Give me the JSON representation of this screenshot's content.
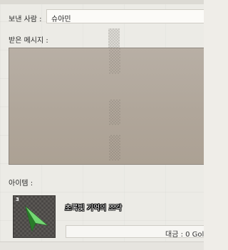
{
  "sender": {
    "label": "보낸 사람 :",
    "value": "슈아민"
  },
  "message": {
    "label": "받은 메시지 :",
    "body": ""
  },
  "item": {
    "label": "아이템 :",
    "name": "초록빛 기억의 조각",
    "count": "3",
    "icon": "green-crystal-shard-icon"
  },
  "payment": {
    "label": "대금 : 0 Gol"
  }
}
